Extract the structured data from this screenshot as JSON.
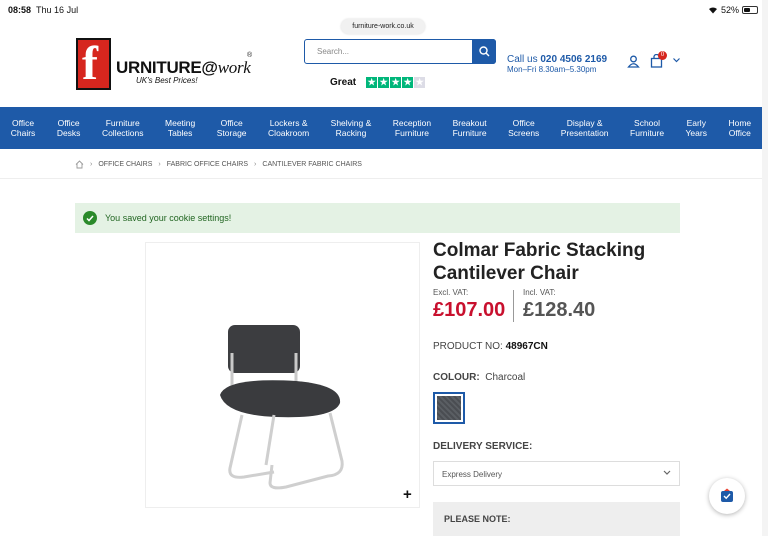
{
  "status": {
    "time": "08:58",
    "date": "Thu 16 Jul",
    "battery": "52%",
    "battery_level": 0.52
  },
  "url": "furniture-work.co.uk",
  "logo": {
    "letter": "f",
    "text_bold": "URNITURE@",
    "text_italic": "work",
    "reg": "®",
    "tagline": "UK's Best Prices!"
  },
  "search": {
    "placeholder": "Search..."
  },
  "trust": {
    "label": "Great",
    "stars": 4
  },
  "contact": {
    "prefix": "Call us",
    "phone": "020 4506 2169",
    "hours": "Mon–Fri 8.30am–5.30pm"
  },
  "cart": {
    "count": "0"
  },
  "nav": [
    "Office\nChairs",
    "Office\nDesks",
    "Furniture\nCollections",
    "Meeting\nTables",
    "Office\nStorage",
    "Lockers &\nCloakroom",
    "Shelving &\nRacking",
    "Reception\nFurniture",
    "Breakout\nFurniture",
    "Office\nScreens",
    "Display &\nPresentation",
    "School\nFurniture",
    "Early\nYears",
    "Home\nOffice"
  ],
  "breadcrumb": [
    "OFFICE CHAIRS",
    "FABRIC OFFICE CHAIRS",
    "CANTILEVER FABRIC CHAIRS"
  ],
  "alert": "You saved your cookie settings!",
  "product": {
    "title": "Colmar Fabric Stacking Cantilever Chair",
    "excl_label": "Excl. VAT:",
    "excl_price": "£107.00",
    "incl_label": "Incl. VAT:",
    "incl_price": "£128.40",
    "pno_label": "PRODUCT NO:",
    "pno": "48967CN",
    "colour_label": "COLOUR:",
    "colour": "Charcoal",
    "delivery_label": "DELIVERY SERVICE:",
    "delivery_value": "Express Delivery",
    "note_label": "PLEASE NOTE:",
    "zoom": "+"
  },
  "colors": {
    "brand": "#1e5aa8",
    "price": "#c8102e",
    "logo_red": "#d6261e",
    "trustpilot": "#00b67a"
  }
}
